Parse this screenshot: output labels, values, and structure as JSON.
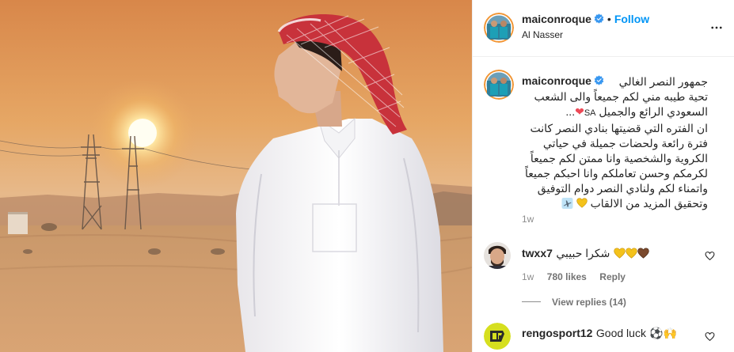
{
  "header": {
    "username": "maiconroque",
    "dot": "•",
    "follow_label": "Follow",
    "location": "Al Nasser"
  },
  "caption": {
    "username": "maiconroque",
    "line1": "جمهور النصر الغالي",
    "line2": "تحية طيبه مني لكم جميعاً والى الشعب",
    "line3": "السعودي الرائع والجميل",
    "flag_text": "SA",
    "heart": "❤",
    "ellipsis": "...",
    "line4": "ان الفتره التي قضيتها بنادي النصر كانت",
    "line5": "فترة رائعة ولحضات جميلة في حياتي",
    "line6": "الكروية والشخصية وانا ممتن لكم جميعاً",
    "line7": "لكرمكم وحسن تعاملكم وانا احبكم جميعاً",
    "line8": "واتمناء لكم ولنادي النصر دوام التوفيق",
    "line9": "وتحقيق المزيد من الالقاب",
    "time": "1w"
  },
  "comments": [
    {
      "username": "twxx7",
      "text": "شكرا حبيبي",
      "time": "1w",
      "likes": "780 likes",
      "reply_label": "Reply",
      "view_replies": "View replies (14)"
    },
    {
      "username": "rengosport12",
      "text": "Good luck",
      "emoji1": "⚽",
      "emoji2": "🙌"
    }
  ],
  "colors": {
    "accent": "#0095f6",
    "verified": "#3897f0",
    "heart_red": "#ed4956",
    "gold_heart": "#f4c21b",
    "muted": "#8e8e8e",
    "border": "#efefef"
  },
  "icons": {
    "verified": "verified-badge-icon",
    "more": "more-options-icon",
    "like": "heart-outline-icon",
    "plane": "airplane-icon",
    "gold_heart": "yellow-heart-icon",
    "brown_heart": "brown-heart-icon"
  }
}
